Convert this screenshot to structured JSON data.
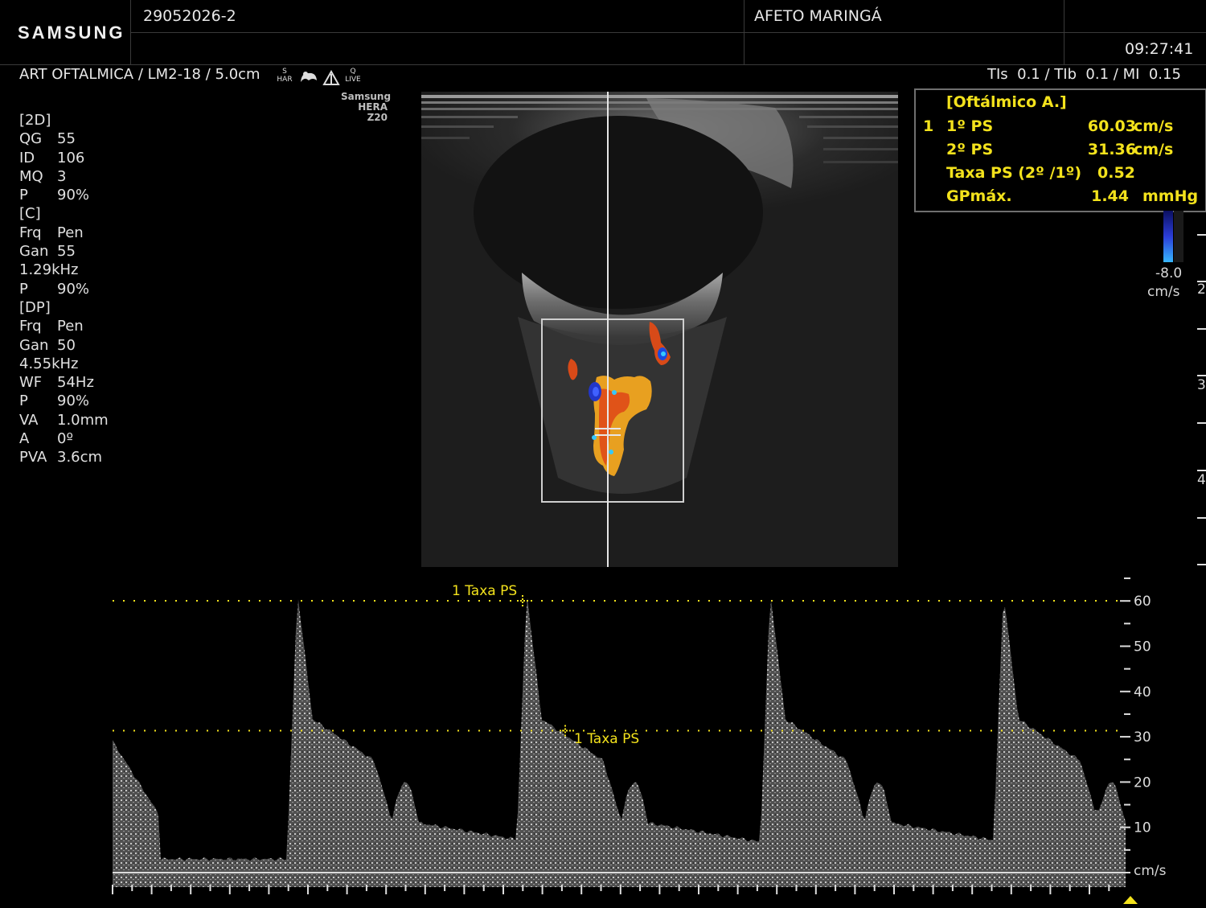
{
  "header": {
    "brand": "SAMSUNG",
    "patient_id": "29052026-2",
    "institution": "AFETO MARINGÁ",
    "time": "09:27:41"
  },
  "probe_line": {
    "preset": "ART OFTALMICA / LM2-18 / 5.0cm",
    "icons": [
      "har-icon",
      "organ-icon",
      "triangle-icon",
      "qlive-icon"
    ],
    "har_label_top": "S",
    "har_label": "HAR",
    "qlive_top": "Q",
    "qlive_label": "LIVE",
    "indices": "TIs  0.1 / TIb  0.1 / MI  0.15"
  },
  "device_logo": {
    "line1": "Samsung",
    "line2": "HERA Z20"
  },
  "params": [
    {
      "k": "[2D]",
      "v": ""
    },
    {
      "k": "QG",
      "v": "55"
    },
    {
      "k": "ID",
      "v": "106"
    },
    {
      "k": "MQ",
      "v": "3"
    },
    {
      "k": "P",
      "v": "90%"
    },
    {
      "k": "[C]",
      "v": ""
    },
    {
      "k": "Frq",
      "v": "Pen"
    },
    {
      "k": "Gan",
      "v": "55"
    },
    {
      "k": "1.29kHz",
      "v": ""
    },
    {
      "k": "P",
      "v": "90%"
    },
    {
      "k": "[DP]",
      "v": ""
    },
    {
      "k": "Frq",
      "v": "Pen"
    },
    {
      "k": "Gan",
      "v": "50"
    },
    {
      "k": "4.55kHz",
      "v": ""
    },
    {
      "k": "WF",
      "v": "54Hz"
    },
    {
      "k": "P",
      "v": "90%"
    },
    {
      "k": "VA",
      "v": "1.0mm"
    },
    {
      "k": "A",
      "v": "0º"
    },
    {
      "k": "PVA",
      "v": "3.6cm"
    }
  ],
  "measurements": {
    "title": "[Oftálmico A.]",
    "index": "1",
    "rows": [
      {
        "label": "1º PS",
        "value": "60.03",
        "unit": "cm/s"
      },
      {
        "label": "2º PS",
        "value": "31.36",
        "unit": "cm/s"
      },
      {
        "label": "Taxa PS (2º /1º)",
        "value": "0.52",
        "unit": ""
      },
      {
        "label": "GPmáx.",
        "value": "1.44",
        "unit": "mmHg"
      }
    ]
  },
  "color_scale": {
    "min": "-8.0",
    "unit": "cm/s"
  },
  "depth_marks": [
    "2",
    "3",
    "4"
  ],
  "doppler": {
    "ticks": [
      "60",
      "50",
      "40",
      "30",
      "20",
      "10"
    ],
    "unit": "cm/s",
    "marker1_label": "1 Taxa PS",
    "marker2_label": "1 Taxa PS",
    "ps1": 60.03,
    "ps2": 31.36
  }
}
